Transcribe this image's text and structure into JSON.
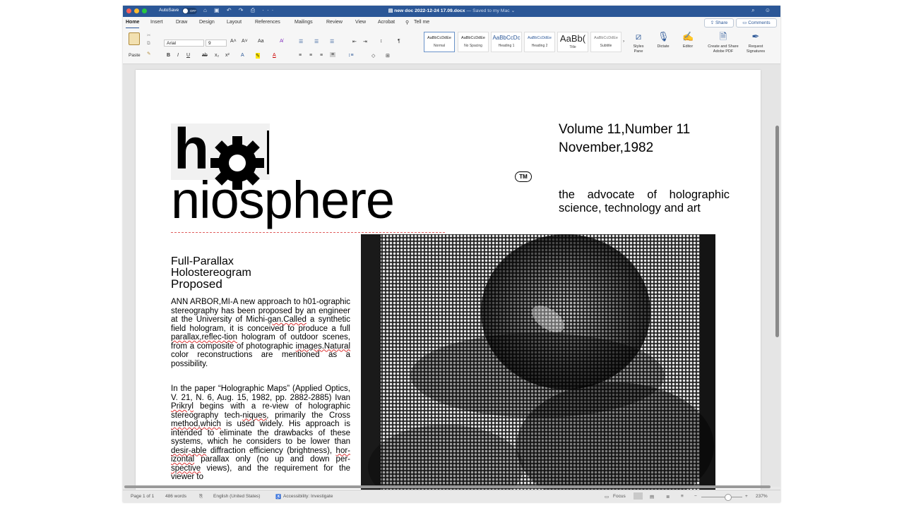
{
  "window": {
    "autosave_label": "AutoSave",
    "autosave_state": "OFF",
    "doc_name": "new doc 2022-12-24 17.09.docx",
    "saved_status": " — Saved to my Mac ⌄",
    "quick_icons": "⌂ ▣ ↶ ↷ ⎙ ···",
    "right_icons": "⌕ ☺"
  },
  "tabs": [
    "Home",
    "Insert",
    "Draw",
    "Design",
    "Layout",
    "References",
    "Mailings",
    "Review",
    "View",
    "Acrobat"
  ],
  "tell_me": "Tell me",
  "share_label": "Share",
  "comments_label": "Comments",
  "ribbon": {
    "paste_label": "Paste",
    "font_name": "Arial",
    "font_size": "9",
    "styles": [
      {
        "sample": "AaBbCcDdEe",
        "name": "Normal"
      },
      {
        "sample": "AaBbCcDdEe",
        "name": "No Spacing"
      },
      {
        "sample": "AaBbCcDc",
        "name": "Heading 1"
      },
      {
        "sample": "AaBbCcDdEe",
        "name": "Heading 2"
      },
      {
        "sample": "AaBb(",
        "name": "Title"
      },
      {
        "sample": "AaBbCcDdEe",
        "name": "Subtitle"
      }
    ],
    "styles_pane": "Styles Pane",
    "dictate": "Dictate",
    "editor": "Editor",
    "create_share_pdf": "Create and Share Adobe PDF",
    "request_signatures": "Request Signatures"
  },
  "document": {
    "logo_top": "h",
    "logo_word": "niosphere",
    "tm": "TM",
    "volume": "Volume 11,Number 11",
    "date": "November,1982",
    "tagline": "the advocate of holographic science, technology and art",
    "headline": [
      "Full-Parallax",
      "Holostereogram",
      "Proposed"
    ],
    "paragraph1": {
      "a": "ANN ARBOR,MI-A new approach to h01-ographic stereography has been proposed by an engineer at the University of Michi-",
      "w1": "gan.Called",
      "b": " a synthetic field hologram, it is conceived to produce a full ",
      "w2": "parallax,reflec-tion",
      "c": " hologram of outdoor scenes, from a composite of photographic ",
      "w3": "images.Natural",
      "d": " color reconstructions are mentioned as a possibility."
    },
    "paragraph2": {
      "a": "In the paper “Holographic Maps” (Applied Optics, V. 21, N. 6, Aug. 15, 1982, pp. 2882-2885) Ivan ",
      "w1": "Prikryl",
      "b": " begins with a re-view of holographic stereography tech-",
      "w2": "niques,",
      "c": " primarily the Cross ",
      "w3": "method,which",
      "d": " is used widely. His approach is intended to eliminate the drawbacks of these systems, which he considers to be lower than ",
      "w4": "desir-able",
      "e": " diffraction efficiency (brightness), ",
      "w5": "hor-izontal",
      "f": " parallax only (no up and down per-",
      "w6": "spective",
      "g": " views), and the requirement for the viewer to"
    }
  },
  "status": {
    "page": "Page 1 of 1",
    "words": "486 words",
    "language": "English (United States)",
    "accessibility": "Accessibility: Investigate",
    "focus": "Focus",
    "zoom": "237%"
  }
}
